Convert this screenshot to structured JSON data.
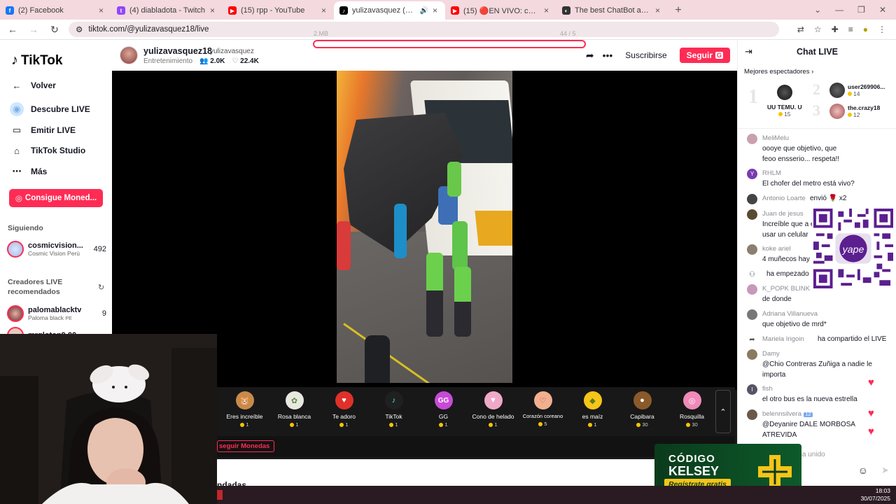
{
  "browser": {
    "tabs": [
      {
        "title": "(2) Facebook",
        "color": "#1877f2",
        "glyph": "f"
      },
      {
        "title": "(4) diabladota - Twitch",
        "color": "#9146ff",
        "glyph": "t"
      },
      {
        "title": "(15) rpp - YouTube",
        "color": "#ff0000",
        "glyph": "▶"
      },
      {
        "title": "yulizavasquez (@yulizavasquez",
        "color": "#000000",
        "glyph": "♪",
        "active": true
      },
      {
        "title": "(15) 🔴EN VIVO: choque de M",
        "color": "#ff0000",
        "glyph": "▶"
      },
      {
        "title": "The best ChatBot and Widget",
        "color": "#333333",
        "glyph": "◐"
      }
    ],
    "url": "tiktok.com/@yulizavasquez18/live"
  },
  "sidebar": {
    "logo": "TikTok",
    "nav": [
      {
        "label": "Volver",
        "icon": "←"
      },
      {
        "label": "Descubre LIVE",
        "icon": "◉"
      },
      {
        "label": "Emitir LIVE",
        "icon": "▭"
      },
      {
        "label": "TikTok Studio",
        "icon": "⌂"
      },
      {
        "label": "Más",
        "icon": "⋯"
      }
    ],
    "coins_button": "Consigue Moned...",
    "following_title": "Siguiendo",
    "following": [
      {
        "name": "cosmicvision...",
        "sub": "Cosmic Vision Perú",
        "count": "492"
      }
    ],
    "recommended_title": "Creadores LIVE recomendados",
    "recommended": [
      {
        "name": "palomablacktv",
        "sub": "Paloma black",
        "region": "PE",
        "count": "9"
      },
      {
        "name": "mrgloton9.00",
        "sub": "",
        "count": ""
      }
    ]
  },
  "stream": {
    "host_name": "yulizavasquez18",
    "host_handle": "yulizavasquez",
    "category": "Entretenimiento",
    "viewers": "2.0K",
    "likes": "22.4K",
    "subscribe_label": "Suscribirse",
    "follow_label": "Seguir",
    "follow_badge": "G",
    "overlay_left": "2.MB",
    "overlay_right": "44 / 5"
  },
  "gifts": [
    {
      "name": "Eres increíble",
      "price": "1",
      "color": "#c88a4a",
      "glyph": "🐹"
    },
    {
      "name": "Rosa blanca",
      "price": "1",
      "color": "#e8e8e0",
      "glyph": "✿"
    },
    {
      "name": "Te adoro",
      "price": "1",
      "color": "#e0302a",
      "glyph": "♥"
    },
    {
      "name": "TikTok",
      "price": "1",
      "color": "#202020",
      "glyph": "♪"
    },
    {
      "name": "GG",
      "price": "1",
      "color": "#c84ad8",
      "glyph": "GG"
    },
    {
      "name": "Cono de helado",
      "price": "1",
      "color": "#f0a8c8",
      "glyph": "▼"
    },
    {
      "name": "Corazón coreano",
      "price": "5",
      "color": "#f0b090",
      "glyph": "♡"
    },
    {
      "name": "es maíz",
      "price": "1",
      "color": "#f5c518",
      "glyph": "◆"
    },
    {
      "name": "Capibara",
      "price": "30",
      "color": "#8a5a2a",
      "glyph": "●"
    },
    {
      "name": "Rosquilla",
      "price": "30",
      "color": "#f08ab8",
      "glyph": "◎"
    }
  ],
  "gift_footer": {
    "get_coins": "seguir Monedas",
    "below_text": "ndadas"
  },
  "chat": {
    "title": "Chat LIVE",
    "top_viewers_label": "Mejores espectadores",
    "top_viewers": [
      {
        "rank": "1",
        "name": "UU TEMU. U",
        "coins": "15"
      },
      {
        "rank": "2",
        "name": "user269906...",
        "coins": "14"
      },
      {
        "rank": "3",
        "name": "the.crazy18",
        "coins": "12"
      }
    ],
    "messages": [
      {
        "user": "MeliMelu",
        "text": "oooye que objetivo, que feoo ensserio... respeta!!"
      },
      {
        "user": "RHLM",
        "text": "El chofer del metro está vivo?"
      },
      {
        "user": "Antonio Loarte",
        "text": "envió 🌹 x2"
      },
      {
        "user": "Juan de jesus",
        "text": "Increíble que a e usar un celular"
      },
      {
        "user": "koke ariel",
        "text": "4 muñecos hay"
      },
      {
        "user": "",
        "text": "ha empezado"
      },
      {
        "user": "K_POPK BLINK",
        "text": "de donde"
      },
      {
        "user": "Adriana Villanueva",
        "text": "que objetivo de mrd*"
      },
      {
        "user": "Mariela Irigoin",
        "text": "ha compartido el LIVE"
      },
      {
        "user": "Damy",
        "text": "@Chio Contreras Zuñiga a nadie le importa"
      },
      {
        "user": "fish",
        "text": "el otro bus es la nueva estrella"
      },
      {
        "user": "belennsilvera",
        "badge": "12",
        "text": "@Deyanire DALE MORBOSA ATREVIDA"
      },
      {
        "user": "",
        "text": "se ha unido"
      }
    ],
    "qr_label": "yape"
  },
  "ad": {
    "line1": "CÓDIGO",
    "line2": "KELSEY",
    "cta": "Regístrate gratis"
  },
  "taskbar": {
    "time": "18:03",
    "date": "30/07/2025"
  },
  "colors": {
    "brand": "#fe2c55",
    "tabstrip": "#f4d9df"
  }
}
